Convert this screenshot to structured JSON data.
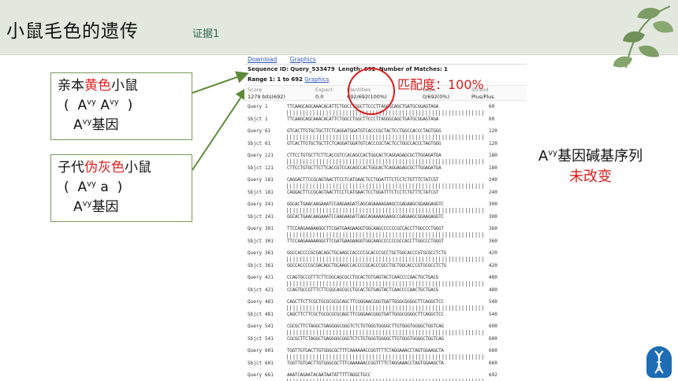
{
  "slide": {
    "title": "小鼠毛色的遗传",
    "subtitle": "证据1"
  },
  "box1": {
    "line1_pre": "亲本",
    "line1_red": "黄色",
    "line1_post": "小鼠",
    "line2_open": "(",
    "line2_a1": "A",
    "line2_s1": "vy",
    "line2_a2": "A",
    "line2_s2": "vy",
    "line2_close": ")",
    "line3_a": "A",
    "line3_s": "vy",
    "line3_post": "基因"
  },
  "box2": {
    "line1_pre": "子代",
    "line1_red": "伪灰色",
    "line1_post": "小鼠",
    "line2_open": "(",
    "line2_a1": "A",
    "line2_s1": "vy",
    "line2_a2": "a",
    "line2_close": ")",
    "line3_a": "A",
    "line3_s": "vy",
    "line3_post": "基因"
  },
  "blast": {
    "download": "Download",
    "graphics": "Graphics",
    "seq_id_label": "Sequence ID:",
    "seq_id": "Query_533479",
    "length_label": "Length:",
    "length": "692",
    "matches_label": "Number of Matches:",
    "matches": "1",
    "range_label": "Range 1: 1 to 692",
    "range_link": "Graphics",
    "stats": {
      "score_k": "Score",
      "score_v": "1279 bits(692)",
      "expect_k": "Expect",
      "expect_v": "0.0",
      "ident_k": "Identities",
      "ident_v": "692/692(100%)",
      "gaps_k": "Gaps",
      "gaps_v": "0/692(0%)",
      "strand_k": "Strand",
      "strand_v": "Plus/Plus"
    },
    "alignment": [
      {
        "q": "Query",
        "s": "Sbjct",
        "start": "1",
        "end": "60",
        "seq": "TTCAAGCAGCAAACACATTCTGGCCTGGCTTCCCTTAGGGCAGCTGATGCGGAGTAGA"
      },
      {
        "q": "Query",
        "s": "Sbjct",
        "start": "61",
        "end": "120",
        "seq": "GTCACTTGTGCTGCTTCTCAGGATGGATGTCACCCGCTACTCCTGGCCACCCTAGTGGG"
      },
      {
        "q": "Query",
        "s": "Sbjct",
        "start": "121",
        "end": "180",
        "seq": "CTTCCTGTGCTTCTTCACCGTCCACAGCCACTGGCACTCAGGAGAGCGCTTGGAGATGA"
      },
      {
        "q": "Query",
        "s": "Sbjct",
        "start": "181",
        "end": "240",
        "seq": "CAGGACTTCCGCAGTAACTTCCTCATGAACTCCTGGATTTCTCCTCTGTTTCTATCGT"
      },
      {
        "q": "Query",
        "s": "Sbjct",
        "start": "241",
        "end": "300",
        "seq": "GGCACTGAACAAGAAATCCAAGAAGATCAGCAGAAAAGAAGCCGAGAAGCGGAAGAGGTC"
      },
      {
        "q": "Query",
        "s": "Sbjct",
        "start": "301",
        "end": "360",
        "seq": "TTCCAAGAAAAAGGCTTCGATGAAGAAGGTGGCAAGCCCCCCGCCACCTTGGCCCTGGGT"
      },
      {
        "q": "Query",
        "s": "Sbjct",
        "start": "361",
        "end": "420",
        "seq": "GGCCACCCCGCGACAGCTGCAAGCCACCCCGCACCCGCCTGCTGGCACCCGTGCGCCTCTG"
      },
      {
        "q": "Query",
        "s": "Sbjct",
        "start": "421",
        "end": "480",
        "seq": "CCAGTGCCGTTTCTTCGGCAGCGCCTGCACTGTGAGTACTCAACCCCAACTGCTGACG"
      },
      {
        "q": "Query",
        "s": "Sbjct",
        "start": "481",
        "end": "540",
        "seq": "CAGCTTCTTCGCTGCGCGCGCAGCTTCGGGAACGGGTGATTGGGCGGGGCTTCAGGCTCC"
      },
      {
        "q": "Query",
        "s": "Sbjct",
        "start": "541",
        "end": "600",
        "seq": "CGCGCTTCTAGGCTGAGGGGCGGGTCTCTGTGGGTGGGGCTTGTGGGTGGGGCTGGTCAG"
      },
      {
        "q": "Query",
        "s": "Sbjct",
        "start": "601",
        "end": "660",
        "seq": "TGGTTGTGACTTGTGGGCGCTTTCAAAAAACCGGTTTTCTAGGAAACCTAGTGGAAGCTA"
      },
      {
        "q": "Query",
        "s": "Sbjct",
        "start": "661",
        "end": "692",
        "seq": "AAATCAGAATACAATAATATTTTTAGGCTGCC"
      }
    ]
  },
  "annotation": {
    "match": "匹配度：100%"
  },
  "conclusion": {
    "line1_a": "A",
    "line1_s": "vy",
    "line1_post": "基因碱基序列",
    "line2": "未改变"
  },
  "colors": {
    "accent_red": "#d91c1c",
    "header_bg": "#e3e8df",
    "arrow_green": "#5f8a3a"
  }
}
